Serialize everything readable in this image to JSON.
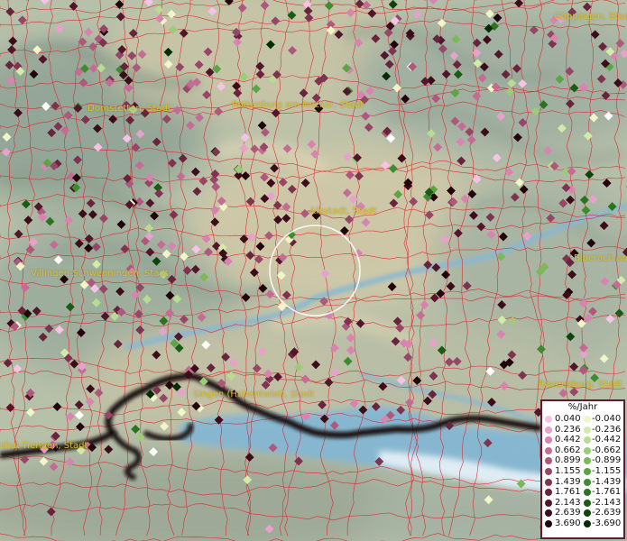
{
  "cities": [
    {
      "name": "Göppingen, Stadt"
    },
    {
      "name": "Dornstetten, Stadt"
    },
    {
      "name": "Rottenburg am Neckar, Stadt"
    },
    {
      "name": "Albstadt, Stadt"
    },
    {
      "name": "Villingen-Schwenningen, Stadt"
    },
    {
      "name": "Biberach an"
    },
    {
      "name": "Singen (Hohentwiel), Stadt"
    },
    {
      "name": "Ravensburg, Stadt"
    },
    {
      "name": "shut-Tiengen, Stadt"
    }
  ],
  "legend": {
    "title": "%/Jahr",
    "positive": [
      {
        "label": "0.040",
        "color": "#f4c4e6"
      },
      {
        "label": "0.236",
        "color": "#e8a0cc"
      },
      {
        "label": "0.442",
        "color": "#d884b0"
      },
      {
        "label": "0.662",
        "color": "#c46c96"
      },
      {
        "label": "0.899",
        "color": "#ad587c"
      },
      {
        "label": "1.155",
        "color": "#964666"
      },
      {
        "label": "1.439",
        "color": "#7e3450"
      },
      {
        "label": "1.761",
        "color": "#68243c"
      },
      {
        "label": "2.143",
        "color": "#52162a"
      },
      {
        "label": "2.639",
        "color": "#3c0c1a"
      },
      {
        "label": "3.690",
        "color": "#22040c"
      }
    ],
    "negative": [
      {
        "label": "-0.040",
        "color": "#f0f6c8"
      },
      {
        "label": "-0.236",
        "color": "#d4eaa8"
      },
      {
        "label": "-0.442",
        "color": "#b8dc90"
      },
      {
        "label": "-0.662",
        "color": "#9ccc78"
      },
      {
        "label": "-0.899",
        "color": "#7cb85a"
      },
      {
        "label": "-1.155",
        "color": "#5ca444"
      },
      {
        "label": "-1.439",
        "color": "#3e8c30"
      },
      {
        "label": "-1.761",
        "color": "#2a7420"
      },
      {
        "label": "-2.143",
        "color": "#1a5c14"
      },
      {
        "label": "-2.639",
        "color": "#0c440a"
      },
      {
        "label": "-3.690",
        "color": "#042c04"
      }
    ]
  },
  "colors": {
    "border_lines": "#e0202a",
    "lake": "#78b4d6",
    "country_border": "#120808",
    "label": "#d8c02a"
  }
}
